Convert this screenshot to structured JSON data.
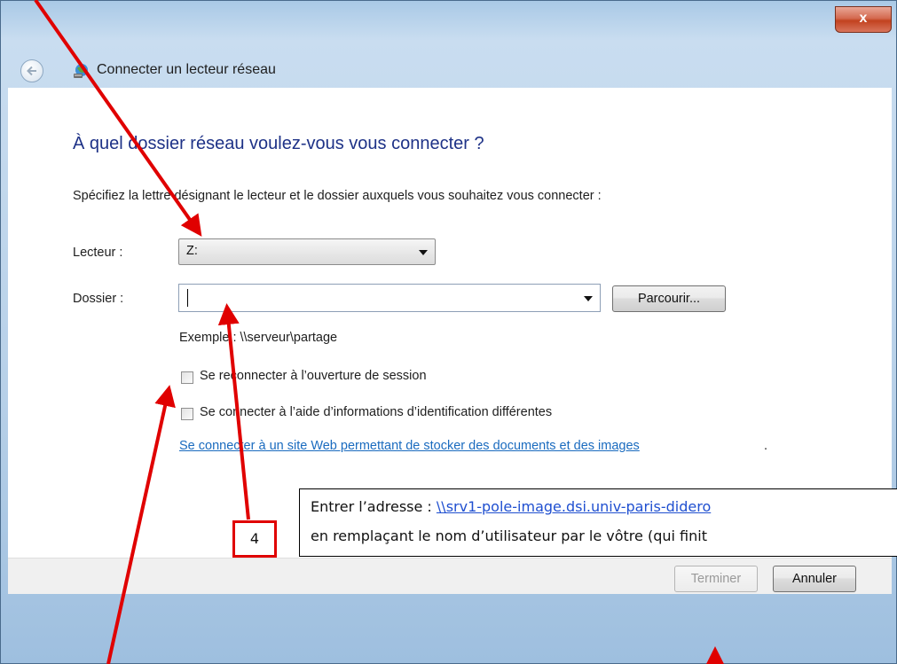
{
  "window": {
    "title": "Connecter un lecteur réseau",
    "close_label": "x"
  },
  "heading": "À quel dossier réseau voulez-vous vous connecter ?",
  "description": "Spécifiez la lettre désignant le lecteur et le dossier auxquels vous souhaitez vous connecter :",
  "drive": {
    "label": "Lecteur :",
    "value": "Z:"
  },
  "folder": {
    "label": "Dossier :",
    "value": "",
    "browse_label": "Parcourir..."
  },
  "example": "Exemple : \\\\serveur\\partage",
  "options": {
    "reconnect_label": "Se reconnecter à l’ouverture de session",
    "reconnect_checked": false,
    "other_credentials_label": "Se connecter à l’aide d’informations d’identification différentes",
    "other_credentials_checked": false
  },
  "web_link": {
    "text": "Se connecter à un site Web permettant de stocker des documents et des images",
    "trailing": "."
  },
  "callout": {
    "line1_prefix": "Entrer l’adresse : ",
    "line1_link": "\\\\srv1-pole-image.dsi.univ-paris-didero",
    "line2": "en remplaçant le nom d’utilisateur par le vôtre (qui finit"
  },
  "step_number": "4",
  "buttons": {
    "finish": "Terminer",
    "cancel": "Annuler"
  },
  "colors": {
    "heading": "#1e3287",
    "link": "#1a6bbf",
    "annotation_red": "#e00000"
  }
}
